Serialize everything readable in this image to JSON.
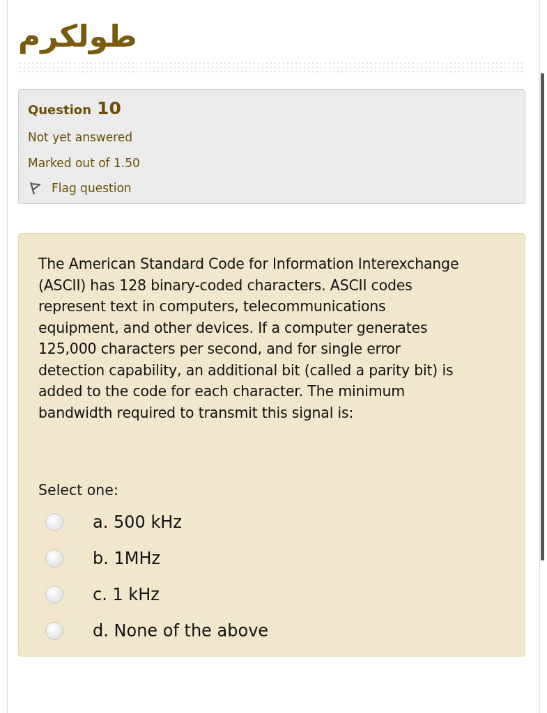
{
  "site_title": "طولكرم",
  "info": {
    "label": "Question",
    "number": "10",
    "status": "Not yet answered",
    "marks": "Marked out of 1.50",
    "flag": {
      "label": "Flag question",
      "flagged": false
    }
  },
  "question": {
    "text": "The American Standard Code for Information Interexchange (ASCII) has 128 binary-coded characters. ASCII codes represent text in computers, telecommunications equipment, and other devices. If a computer generates 125,000 characters per second, and for single error detection capability, an additional bit (called a parity bit) is added to the code for each character. The minimum bandwidth required to transmit this signal is:",
    "prompt": "Select one:",
    "options": [
      {
        "label": "a. 500 kHz",
        "selected": false
      },
      {
        "label": "b. 1MHz",
        "selected": false
      },
      {
        "label": "c. 1 kHz",
        "selected": false
      },
      {
        "label": "d. None of the above",
        "selected": false
      }
    ]
  }
}
